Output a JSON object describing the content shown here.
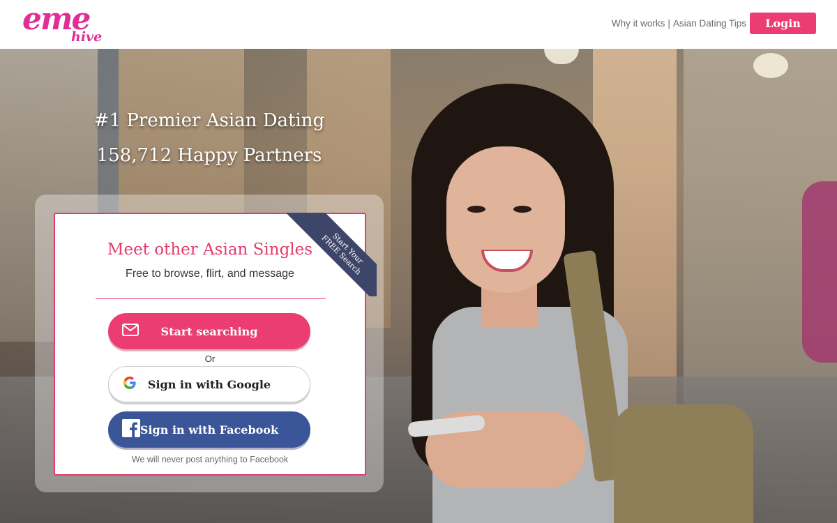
{
  "header": {
    "logo_main": "eme",
    "logo_sub": "hive",
    "nav_links": [
      {
        "label": "Why it works"
      },
      {
        "label": "Asian Dating Tips"
      }
    ],
    "nav_separator": "|",
    "login_label": "Login"
  },
  "hero": {
    "headline_1": "#1 Premier Asian Dating",
    "headline_2": "158,712 Happy Partners"
  },
  "card": {
    "title": "Meet other Asian Singles",
    "subtitle": "Free to browse, flirt, and message",
    "ribbon_line_1": "Start Your",
    "ribbon_line_2": "FREE Search",
    "start_button": {
      "label": "Start searching",
      "icon": "envelope-icon"
    },
    "or_text": "Or",
    "google_button": {
      "label": "Sign in with Google",
      "icon": "google-icon"
    },
    "facebook_button": {
      "label": "Sign in with Facebook",
      "icon": "facebook-icon"
    },
    "facebook_note": "We will never post anything to Facebook"
  },
  "colors": {
    "brand_pink": "#ec3d73",
    "logo_magenta": "#e12e97",
    "facebook_blue": "#3a5598",
    "ribbon_navy": "#3d4669"
  }
}
